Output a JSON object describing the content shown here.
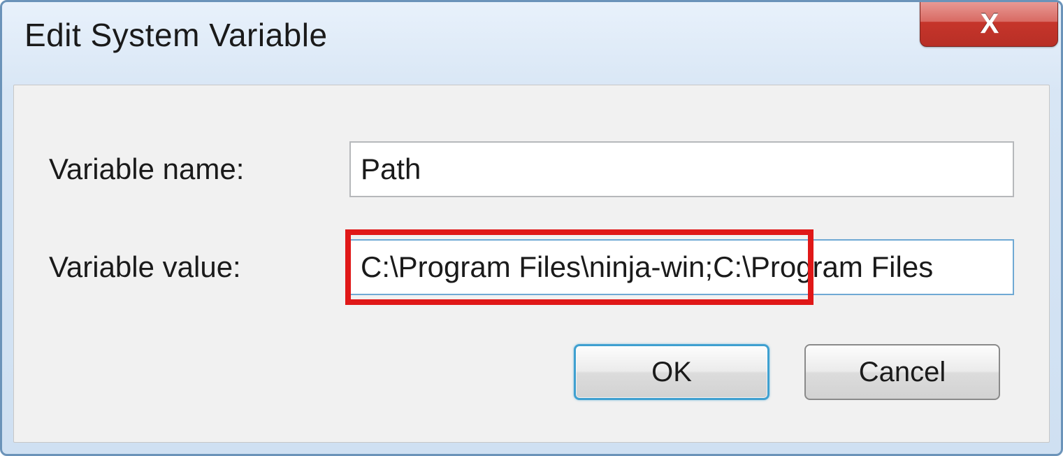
{
  "window": {
    "title": "Edit System Variable"
  },
  "form": {
    "name_label": "Variable name:",
    "name_value": "Path",
    "value_label": "Variable value:",
    "value_value": "C:\\Program Files\\ninja-win;C:\\Program Files"
  },
  "buttons": {
    "ok": "OK",
    "cancel": "Cancel"
  }
}
